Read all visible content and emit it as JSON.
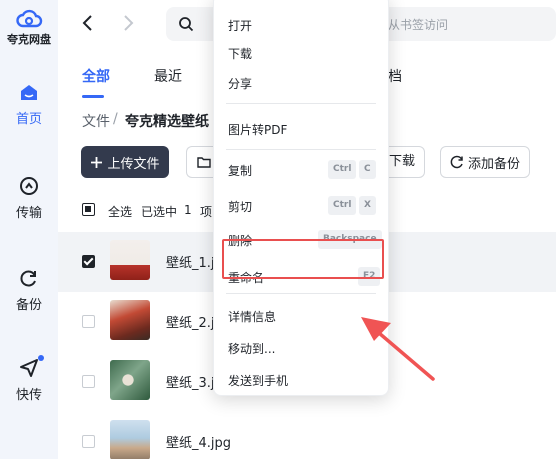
{
  "app": {
    "name": "夸克网盘"
  },
  "sidebar": {
    "items": [
      {
        "label": "首页",
        "icon": "home-icon",
        "active": true
      },
      {
        "label": "传输",
        "icon": "transfer-icon",
        "active": false
      },
      {
        "label": "备份",
        "icon": "backup-icon",
        "active": false
      },
      {
        "label": "快传",
        "icon": "quick-send-icon",
        "active": false,
        "badge": true
      }
    ]
  },
  "search": {
    "hint_visible": "从书签访问"
  },
  "tabs": {
    "all": "全部",
    "recent": "最近",
    "partial": "档"
  },
  "breadcrumb": {
    "root": "文件",
    "separator": "/",
    "current": "夸克精选壁纸"
  },
  "toolbar": {
    "upload": "上传文件",
    "download": "下载",
    "backup": "添加备份"
  },
  "selection": {
    "select_all": "全选",
    "selected_prefix": "已选中",
    "count": "1",
    "suffix": "项"
  },
  "files": [
    {
      "name": "壁纸_1.jp",
      "selected": true
    },
    {
      "name": "壁纸_2.jp",
      "selected": false
    },
    {
      "name": "壁纸_3.jp",
      "selected": false
    },
    {
      "name": "壁纸_4.jpg",
      "selected": false
    }
  ],
  "context_menu": {
    "open": "打开",
    "download": "下载",
    "share": "分享",
    "to_pdf": "图片转PDF",
    "copy": "复制",
    "copy_key1": "Ctrl",
    "copy_key2": "C",
    "cut": "剪切",
    "cut_key1": "Ctrl",
    "cut_key2": "X",
    "delete": "删除",
    "delete_key": "Backspace",
    "rename": "重命名",
    "rename_key": "F2",
    "details": "详情信息",
    "move_to": "移动到...",
    "send_to_phone": "发送到手机"
  },
  "colors": {
    "accent": "#3568f6",
    "highlight": "#e94f4f",
    "dark_button": "#333a4d"
  }
}
